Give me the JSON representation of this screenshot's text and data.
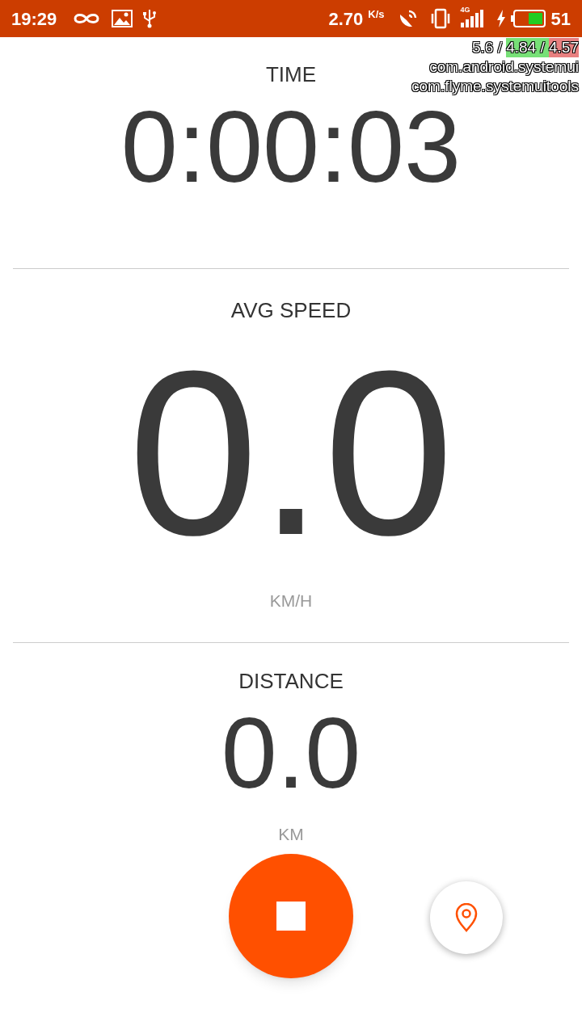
{
  "status_bar": {
    "time": "19:29",
    "speed": "2.70",
    "speed_unit": "K/s",
    "network": "4G",
    "battery": "51"
  },
  "overlay": {
    "load": [
      {
        "text": "5.6 / "
      },
      {
        "text": "4.84 / ",
        "color": "#77e077"
      },
      {
        "text": "4.57",
        "color": "#e88080"
      }
    ],
    "processes": [
      "com.android.systemui",
      "com.flyme.systemuitools"
    ]
  },
  "time": {
    "label": "TIME",
    "value": "0:00:03"
  },
  "avg_speed": {
    "label": "AVG SPEED",
    "value": "0.0",
    "unit": "KM/H"
  },
  "distance": {
    "label": "DISTANCE",
    "value": "0.0",
    "unit": "KM"
  }
}
